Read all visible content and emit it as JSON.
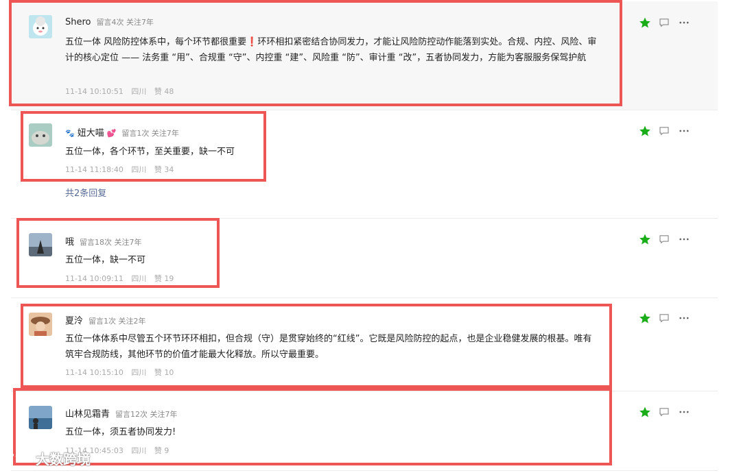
{
  "comments": [
    {
      "nickname": "Shero",
      "stats": "留言4次 关注7年",
      "text_a": "五位一体 风险防控体系中，每个环节都很重要",
      "text_excl": "❗",
      "text_b": "环环相扣紧密结合协同发力，才能让风险防控动作能落到实处。合规、内控、风险、审计的核心定位 —— 法务重 “用”、合规重 “守”、内控重 “建”、风险重 “防”、审计重 “改”，五者协同发力，方能为客服服务保驾护航",
      "time": "11-14 10:10:51",
      "location": "四川",
      "likes": "赞 48"
    },
    {
      "nickname": "妞大喵",
      "nick_prefix": "🐾",
      "nick_suffix": "💕",
      "stats": "留言1次 关注7年",
      "text": "五位一体，各个环节，至关重要，缺一不可",
      "time": "11-14 11:18:40",
      "location": "四川",
      "likes": "赞 34",
      "replies": "共2条回复"
    },
    {
      "nickname": "哦",
      "stats": "留言18次 关注7年",
      "text": "五位一体，缺一不可",
      "time": "11-14 10:09:11",
      "location": "四川",
      "likes": "赞 19"
    },
    {
      "nickname": "夏泠",
      "stats": "留言1次 关注2年",
      "text": "五位一体体系中尽管五个环节环环相扣，但合规（守）是贯穿始终的“红线”。它既是风险防控的起点，也是企业稳健发展的根基。唯有筑牢合规防线，其他环节的价值才能最大化释放。所以守最重要。",
      "time": "11-14 10:15:10",
      "location": "四川",
      "likes": "赞 10"
    },
    {
      "nickname": "山林见霜青",
      "stats": "留言12次 关注7年",
      "text": "五位一体，须五者协同发力!",
      "time": "11-14 10:45:03",
      "location": "四川",
      "likes": "赞 9"
    }
  ],
  "icons": {
    "star": "star-icon",
    "comment": "comment-icon",
    "more": "more-icon"
  },
  "colors": {
    "star": "#1aad19",
    "highlight": "#ee5656",
    "link": "#576b95"
  },
  "watermark": "大数跨境"
}
